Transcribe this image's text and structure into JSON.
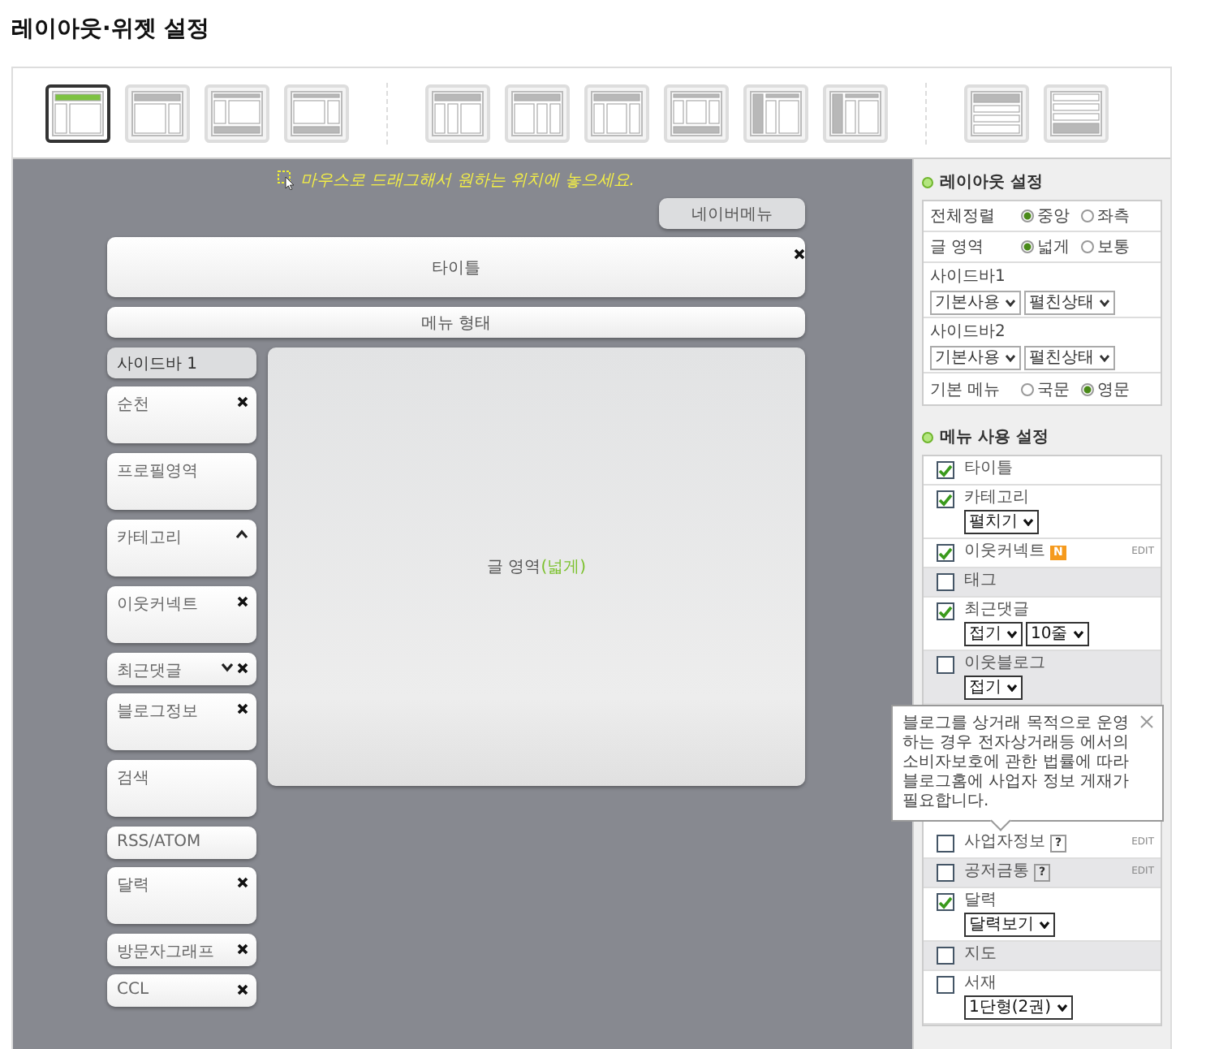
{
  "page_title": "레이아웃·위젯 설정",
  "layouts": [
    {
      "kind": "header-left",
      "selected": true
    },
    {
      "kind": "header-right",
      "selected": false
    },
    {
      "kind": "left-footer",
      "selected": false
    },
    {
      "kind": "right-footer",
      "selected": false
    },
    {
      "kind": "three-left",
      "selected": false
    },
    {
      "kind": "three-right",
      "selected": false
    },
    {
      "kind": "three-center",
      "selected": false
    },
    {
      "kind": "three-footer",
      "selected": false
    },
    {
      "kind": "bar-three",
      "selected": false
    },
    {
      "kind": "bar-two",
      "selected": false
    },
    {
      "kind": "stack-a",
      "selected": false
    },
    {
      "kind": "stack-b",
      "selected": false
    }
  ],
  "canvas": {
    "hint": "마우스로 드래그해서 원하는 위치에 놓으세요.",
    "nav_menu": "네이버메뉴",
    "title_block": "타이틀",
    "menu_block": "메뉴 형태",
    "sidebar": {
      "title": "사이드바 1",
      "widgets": [
        {
          "label": "순천",
          "kind": "tall",
          "close": true
        },
        {
          "label": "프로필영역",
          "kind": "tall",
          "close": false
        },
        {
          "label": "카테고리",
          "kind": "tall",
          "close": false,
          "expanded": true
        },
        {
          "label": "이웃커넥트",
          "kind": "tall",
          "close": true
        },
        {
          "label": "최근댓글",
          "kind": "short",
          "close": true,
          "expanded": false
        },
        {
          "label": "블로그정보",
          "kind": "tall",
          "close": true
        },
        {
          "label": "검색",
          "kind": "tall",
          "close": false
        },
        {
          "label": "RSS/ATOM",
          "kind": "short",
          "close": false
        },
        {
          "label": "달력",
          "kind": "tall",
          "close": true
        },
        {
          "label": "방문자그래프",
          "kind": "short",
          "close": true
        },
        {
          "label": "CCL",
          "kind": "short",
          "close": true
        }
      ]
    },
    "content_area": {
      "label": "글 영역",
      "mode": "(넓게)"
    }
  },
  "layout_settings": {
    "title": "레이아웃 설정",
    "rows": [
      {
        "kind": "radio",
        "label": "전체정렬",
        "options": [
          {
            "label": "중앙",
            "selected": true
          },
          {
            "label": "좌측",
            "selected": false
          }
        ]
      },
      {
        "kind": "radio",
        "label": "글 영역",
        "options": [
          {
            "label": "넓게",
            "selected": true
          },
          {
            "label": "보통",
            "selected": false
          }
        ]
      },
      {
        "kind": "select",
        "label": "사이드바1",
        "selects": [
          "기본사용",
          "펼친상태"
        ]
      },
      {
        "kind": "select",
        "label": "사이드바2",
        "selects": [
          "기본사용",
          "펼친상태"
        ]
      },
      {
        "kind": "radio",
        "label": "기본 메뉴",
        "options": [
          {
            "label": "국문",
            "selected": false
          },
          {
            "label": "영문",
            "selected": true
          }
        ]
      }
    ]
  },
  "menu_settings": {
    "title": "메뉴 사용 설정",
    "items": [
      {
        "label": "타이틀",
        "checked": true,
        "shaded": false
      },
      {
        "label": "카테고리",
        "checked": true,
        "shaded": false,
        "selects": [
          "펼치기"
        ]
      },
      {
        "label": "이웃커넥트",
        "checked": true,
        "shaded": false,
        "badge": "N",
        "edit": "EDIT"
      },
      {
        "label": "태그",
        "checked": false,
        "shaded": true
      },
      {
        "label": "최근댓글",
        "checked": true,
        "shaded": false,
        "selects": [
          "접기",
          "10줄"
        ]
      },
      {
        "label": "이웃블로그",
        "checked": false,
        "shaded": true,
        "selects": [
          "접기"
        ]
      },
      {
        "kind": "tooltip",
        "text": "블로그를 상거래 목적으로 운영하는 경우 전자상거래등 에서의 소비자보호에 관한 법률에 따라 블로그홈에 사업자 정보 게재가 필요합니다."
      },
      {
        "label": "사업자정보",
        "checked": false,
        "shaded": false,
        "help": "?",
        "edit": "EDIT"
      },
      {
        "label": "공저금통",
        "checked": false,
        "shaded": true,
        "help": "?",
        "edit": "EDIT"
      },
      {
        "label": "달력",
        "checked": true,
        "shaded": false,
        "selects": [
          "달력보기"
        ]
      },
      {
        "label": "지도",
        "checked": false,
        "shaded": true
      },
      {
        "label": "서재",
        "checked": false,
        "shaded": false,
        "selects": [
          "1단형(2권)"
        ]
      }
    ]
  }
}
